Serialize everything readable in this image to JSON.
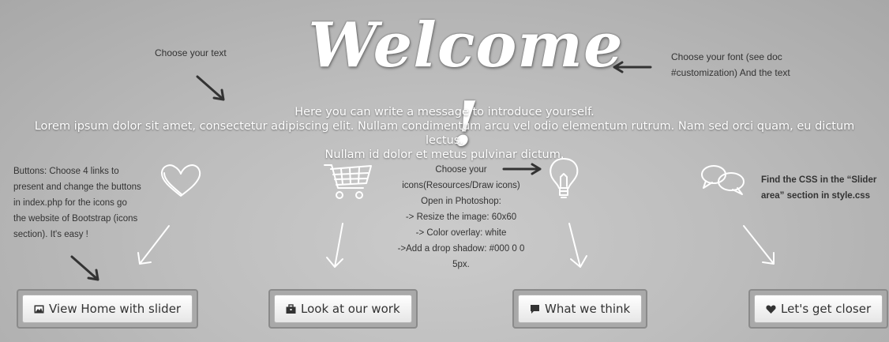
{
  "welcome": "Welcome !",
  "intro": {
    "line1": "Here you can write a message to introduce yourself.",
    "line2": "Lorem ipsum dolor sit amet, consectetur adipiscing elit. Nullam condimentum arcu vel odio elementum rutrum. Nam sed orci quam, eu dictum lectus.",
    "line3": "Nullam id dolor et metus pulvinar dictum."
  },
  "notes": {
    "text": "Choose your text",
    "font": [
      "Choose your font (see doc",
      "#customization) And the text"
    ],
    "buttons": [
      "Buttons: Choose 4 links to",
      "present and change the buttons",
      "in index.php for the icons go",
      "the website of Bootstrap (icons",
      "section). It's easy !"
    ],
    "icons": [
      "Choose your",
      "icons(Resources/Draw icons)",
      "Open in Photoshop:",
      "-> Resize the image: 60x60",
      "-> Color overlay: white",
      "->Add a drop shadow: #000 0 0",
      "5px."
    ],
    "css": [
      "Find the CSS in the “Slider",
      "area” section in style.css"
    ]
  },
  "buttons": [
    {
      "label": "View Home with slider",
      "icon": "picture-icon"
    },
    {
      "label": "Look at our work",
      "icon": "briefcase-icon"
    },
    {
      "label": "What we think",
      "icon": "comment-icon"
    },
    {
      "label": "Let's get closer",
      "icon": "heart-icon"
    }
  ],
  "colors": {
    "text_white": "#ffffff",
    "note_text": "#333333",
    "button_bg": "#f5f5f5"
  }
}
